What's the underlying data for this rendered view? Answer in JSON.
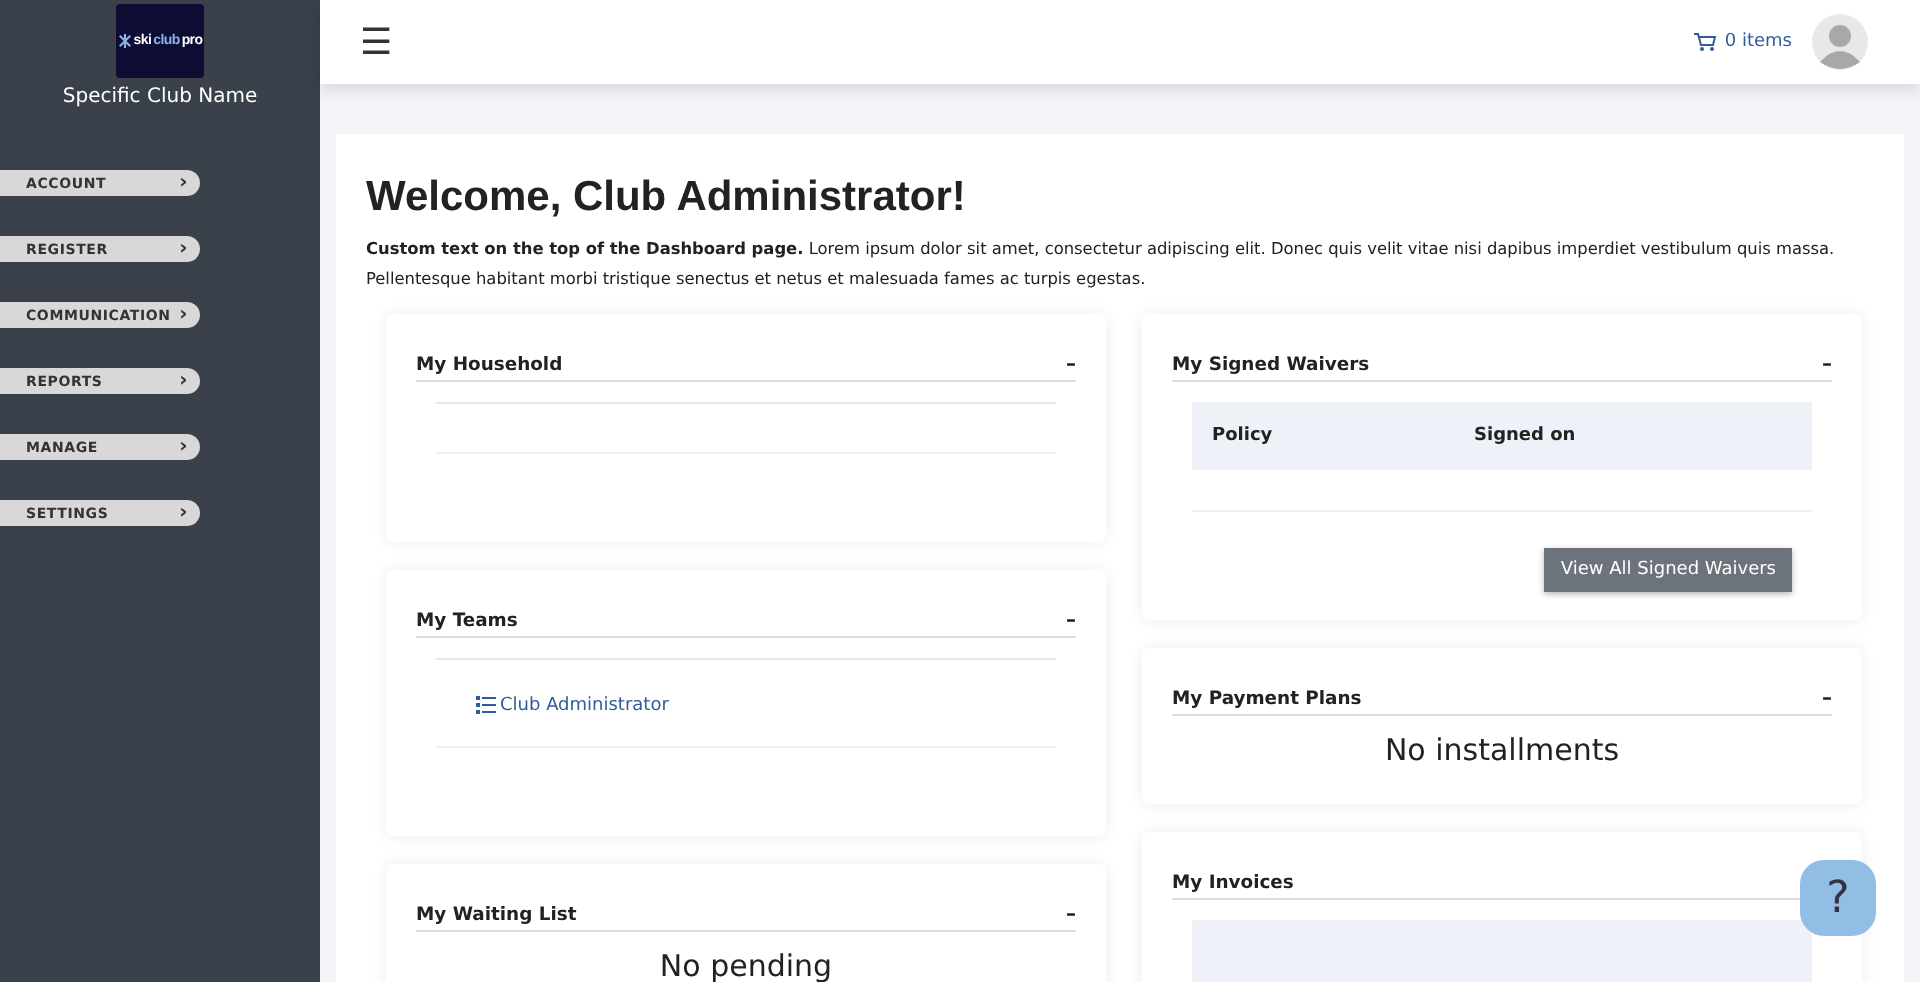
{
  "sidebar": {
    "logo_text": [
      "ski",
      "club",
      "pro"
    ],
    "club_name": "Specific Club Name",
    "items": [
      {
        "label": "ACCOUNT",
        "chevron": "›"
      },
      {
        "label": "REGISTER",
        "chevron": "›"
      },
      {
        "label": "COMMUNICATION",
        "chevron": "›"
      },
      {
        "label": "REPORTS",
        "chevron": "›"
      },
      {
        "label": "MANAGE",
        "chevron": "›"
      },
      {
        "label": "SETTINGS",
        "chevron": "›"
      }
    ]
  },
  "topbar": {
    "menu_icon": "☰",
    "cart": "0 items"
  },
  "page": {
    "title": "Welcome, Club Administrator!",
    "intro": "**Custom text on the top of the Dashboard page.**  Lorem ipsum dolor sit amet, consectetur adipiscing elit. Donec quis velit vitae nisi dapibus imperdiet vestibulum quis massa. Pellentesque habitant morbi tristique senectus et netus et malesuada fames ac turpis egestas."
  },
  "columns": [
    [
      {
        "title": "My Household",
        "toggle": "–",
        "kind": "list"
      },
      {
        "title": "My Teams",
        "toggle": "–",
        "kind": "list",
        "items": [
          "Club Administrator"
        ]
      },
      {
        "title": "My Waiting List",
        "toggle": "–",
        "kind": "message",
        "message": "No pending"
      }
    ],
    [
      {
        "title": "My Signed Waivers",
        "toggle": "–",
        "kind": "table",
        "columns": [
          "Policy",
          "Signed on"
        ],
        "button": "View All Signed Waivers"
      },
      {
        "title": "My Payment Plans",
        "toggle": "–",
        "kind": "message",
        "message": "No installments"
      },
      {
        "title": "My Invoices",
        "kind": "table"
      }
    ]
  ],
  "help_button": "?"
}
